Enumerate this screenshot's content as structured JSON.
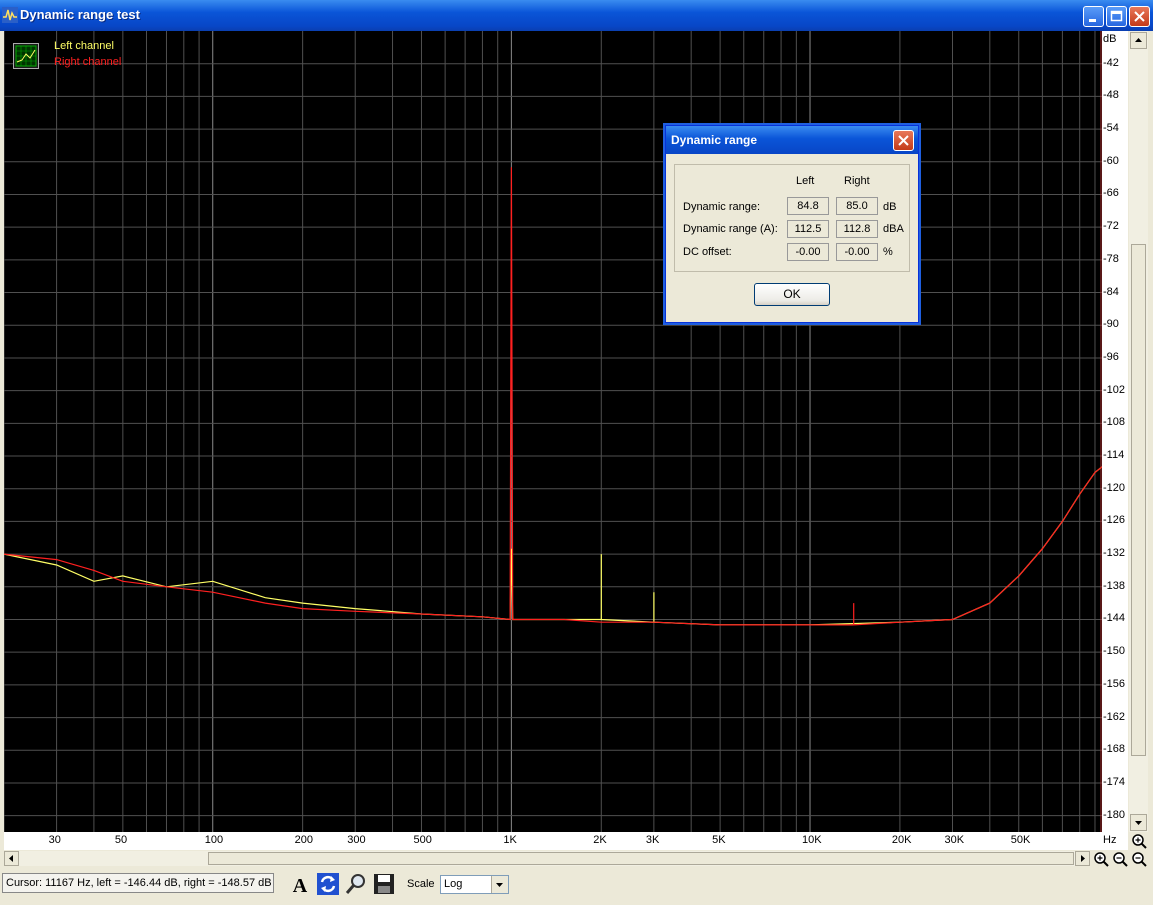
{
  "window": {
    "title": "Dynamic range test"
  },
  "legend": {
    "left": "Left channel",
    "right": "Right channel",
    "left_color": "#ffff66",
    "right_color": "#ff2020"
  },
  "chart_data": {
    "type": "line",
    "xscale": "log",
    "xlim": [
      20,
      95000
    ],
    "ylim": [
      -183,
      -36
    ],
    "xlabel": "Hz",
    "ylabel": "dB",
    "grid": true,
    "y_ticks": [
      "-42",
      "-48",
      "-54",
      "-60",
      "-66",
      "-72",
      "-78",
      "-84",
      "-90",
      "-96",
      "-102",
      "-108",
      "-114",
      "-120",
      "-126",
      "-132",
      "-138",
      "-144",
      "-150",
      "-156",
      "-162",
      "-168",
      "-174",
      "-180"
    ],
    "x_tick_labels": [
      "30",
      "50",
      "100",
      "200",
      "300",
      "500",
      "1K",
      "2K",
      "3K",
      "5K",
      "10K",
      "20K",
      "30K",
      "50K"
    ],
    "x_tick_values": [
      30,
      50,
      100,
      200,
      300,
      500,
      1000,
      2000,
      3000,
      5000,
      10000,
      20000,
      30000,
      50000
    ],
    "series": [
      {
        "name": "Left channel",
        "color": "#ffff66",
        "x": [
          20,
          30,
          40,
          50,
          70,
          100,
          150,
          200,
          300,
          500,
          800,
          990,
          1000,
          1010,
          1200,
          1500,
          2000,
          2000,
          2000,
          3000,
          3000,
          3000,
          5000,
          10000,
          20000,
          30000,
          40000,
          50000,
          60000,
          70000,
          80000,
          90000,
          95000
        ],
        "y": [
          -132,
          -134,
          -137,
          -136,
          -138,
          -137,
          -140,
          -141,
          -142,
          -143,
          -143.5,
          -144,
          -131,
          -144,
          -144,
          -144,
          -144,
          -132,
          -144,
          -144.5,
          -139,
          -144.5,
          -145,
          -145,
          -144.5,
          -144,
          -141,
          -136,
          -131,
          -126,
          -121,
          -117,
          -116
        ]
      },
      {
        "name": "Right channel",
        "color": "#ff2020",
        "x": [
          20,
          30,
          40,
          50,
          70,
          100,
          150,
          200,
          300,
          500,
          800,
          990,
          1000,
          1010,
          1200,
          1500,
          2000,
          3000,
          5000,
          10000,
          14000,
          14000,
          14000,
          20000,
          30000,
          40000,
          50000,
          60000,
          70000,
          80000,
          90000,
          95000
        ],
        "y": [
          -132,
          -133,
          -135,
          -137,
          -138,
          -139,
          -141,
          -142,
          -142.5,
          -143,
          -143.5,
          -144,
          -61,
          -144,
          -144,
          -144,
          -144.5,
          -144.5,
          -145,
          -145,
          -145,
          -141,
          -145,
          -144.5,
          -144,
          -141,
          -136,
          -131,
          -126,
          -121,
          -117,
          -116
        ]
      }
    ]
  },
  "dialog": {
    "title": "Dynamic range",
    "col_left": "Left",
    "col_right": "Right",
    "rows": [
      {
        "label": "Dynamic range:",
        "left": "84.8",
        "right": "85.0",
        "unit": "dB"
      },
      {
        "label": "Dynamic range (A):",
        "left": "112.5",
        "right": "112.8",
        "unit": "dBA"
      },
      {
        "label": "DC offset:",
        "left": "-0.00",
        "right": "-0.00",
        "unit": "%"
      }
    ],
    "ok_label": "OK"
  },
  "status": {
    "cursor": "Cursor:  11167 Hz,  left = -146.44 dB,  right = -148.57 dB"
  },
  "toolbar": {
    "scale_label": "Scale",
    "scale_value": "Log"
  },
  "icons": [
    "app-icon",
    "minimize-icon",
    "maximize-icon",
    "close-icon",
    "legend-grid-icon",
    "font-icon",
    "refresh-icon",
    "zoom-tool-icon",
    "save-icon",
    "zoom-in-icon",
    "zoom-out-icon"
  ]
}
